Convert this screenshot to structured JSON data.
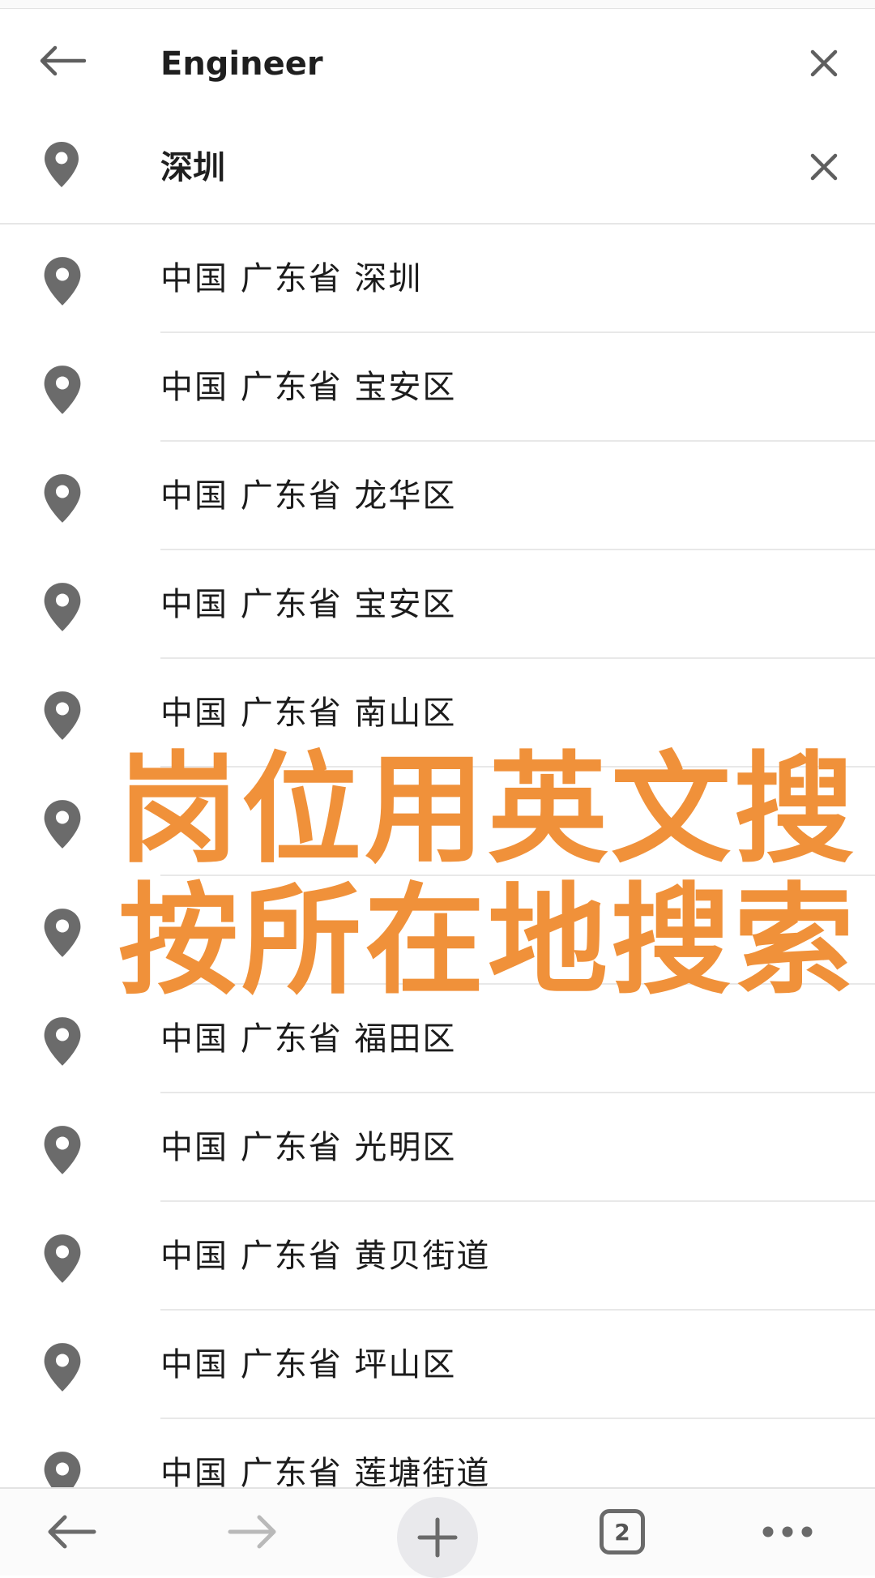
{
  "search": {
    "keyword": "Engineer",
    "location": "深圳"
  },
  "suggestions": [
    {
      "label": "中国 广东省 深圳"
    },
    {
      "label": "中国 广东省 宝安区"
    },
    {
      "label": "中国 广东省 龙华区"
    },
    {
      "label": "中国 广东省 宝安区"
    },
    {
      "label": "中国 广东省 南山区"
    },
    {
      "label": ""
    },
    {
      "label": ""
    },
    {
      "label": "中国 广东省 福田区"
    },
    {
      "label": "中国 广东省 光明区"
    },
    {
      "label": "中国 广东省 黄贝街道"
    },
    {
      "label": "中国 广东省 坪山区"
    },
    {
      "label": "中国 广东省 莲塘街道"
    }
  ],
  "overlay": {
    "line1": "岗位用英文搜",
    "line2": "按所在地搜索"
  },
  "bottom_bar": {
    "tab_count": "2"
  },
  "colors": {
    "accent": "#f0913a",
    "icon": "#6b6b6b"
  },
  "icons": [
    "back-arrow-icon",
    "close-icon",
    "location-pin-icon",
    "forward-arrow-icon",
    "plus-icon",
    "tabs-icon",
    "more-icon"
  ]
}
